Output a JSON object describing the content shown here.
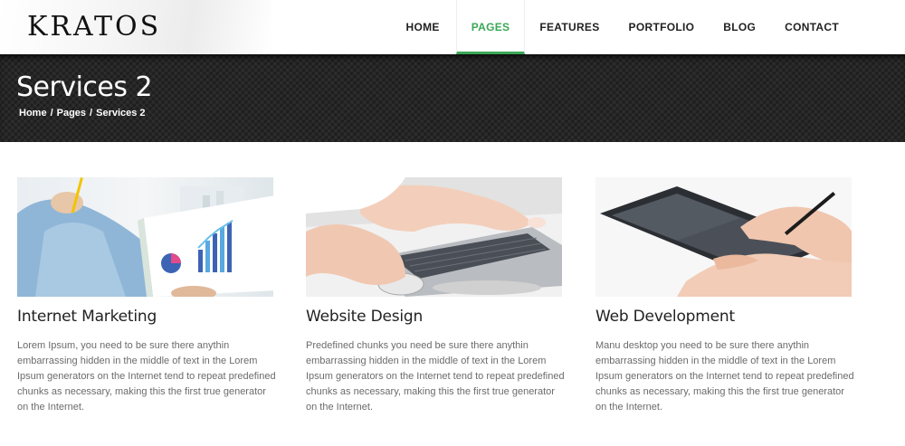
{
  "header": {
    "logo": "KRATOS",
    "nav": [
      {
        "label": "HOME"
      },
      {
        "label": "PAGES"
      },
      {
        "label": "FEATURES"
      },
      {
        "label": "PORTFOLIO"
      },
      {
        "label": "BLOG"
      },
      {
        "label": "CONTACT"
      }
    ],
    "active_nav": "PAGES",
    "accent_color": "#3aa757"
  },
  "banner": {
    "title": "Services 2",
    "breadcrumb": {
      "items": [
        "Home",
        "Pages",
        "Services 2"
      ],
      "separator": "/"
    }
  },
  "services": [
    {
      "title": "Internet Marketing",
      "text": "Lorem Ipsum, you need to be sure there anythin embarrassing hidden in the middle of text in the Lorem Ipsum generators on the Internet tend to repeat predefined chunks as necessary, making this the first true generator on the Internet."
    },
    {
      "title": "Website Design",
      "text": "Predefined chunks you need be sure there anythin embarrassing hidden in the middle of text in the Lorem Ipsum generators on the Internet tend to repeat predefined chunks as necessary, making this the first true generator on the Internet."
    },
    {
      "title": "Web Development",
      "text": "Manu desktop you need to be sure there anythin embarrassing hidden in the middle of text in the Lorem Ipsum generators on the Internet tend to repeat predefined chunks as necessary, making this the first true generator on the Internet."
    }
  ]
}
